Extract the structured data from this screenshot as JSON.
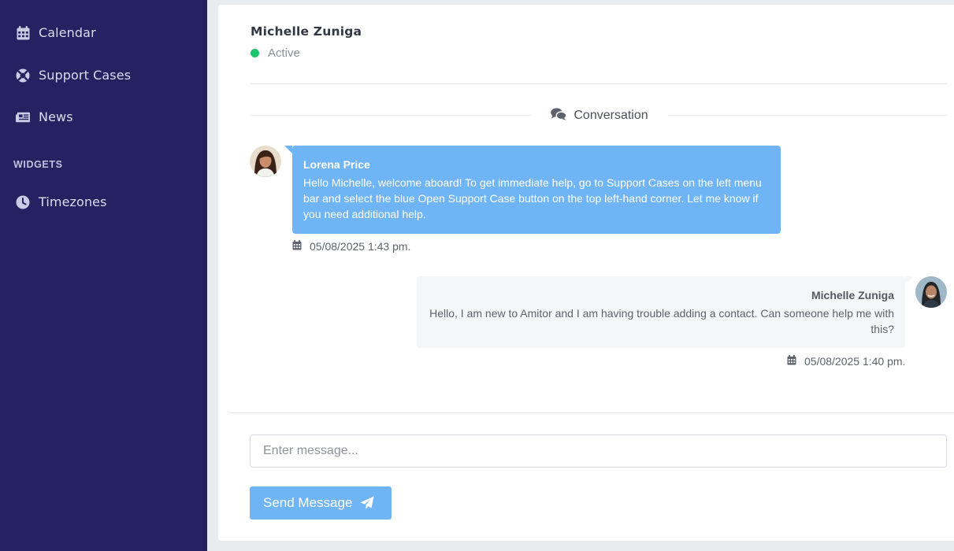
{
  "sidebar": {
    "items": [
      {
        "label": "Calendar",
        "icon": "calendar-icon"
      },
      {
        "label": "Support Cases",
        "icon": "life-ring-icon"
      },
      {
        "label": "News",
        "icon": "newspaper-icon"
      }
    ],
    "section_label": "WIDGETS",
    "widgets": [
      {
        "label": "Timezones",
        "icon": "clock-icon"
      }
    ],
    "background_color": "#262262"
  },
  "contact": {
    "name": "Michelle Zuniga",
    "status": "Active",
    "status_color": "#1cc56e"
  },
  "conversation": {
    "heading": "Conversation",
    "messages": [
      {
        "sender": "Lorena Price",
        "text": "Hello Michelle, welcome aboard! To get immediate help, go to Support Cases on the left menu bar and select the blue Open Support Case button on the top left-hand corner. Let me know if you need additional help.",
        "timestamp": "05/08/2025 1:43 pm."
      },
      {
        "sender": "Michelle Zuniga",
        "text": "Hello, I am new to Amitor and I am having trouble adding a contact. Can someone help me with this?",
        "timestamp": "05/08/2025 1:40 pm."
      }
    ]
  },
  "composer": {
    "placeholder": "Enter message...",
    "value": "",
    "send_label": "Send Message"
  },
  "colors": {
    "accent": "#6fb5f5"
  }
}
